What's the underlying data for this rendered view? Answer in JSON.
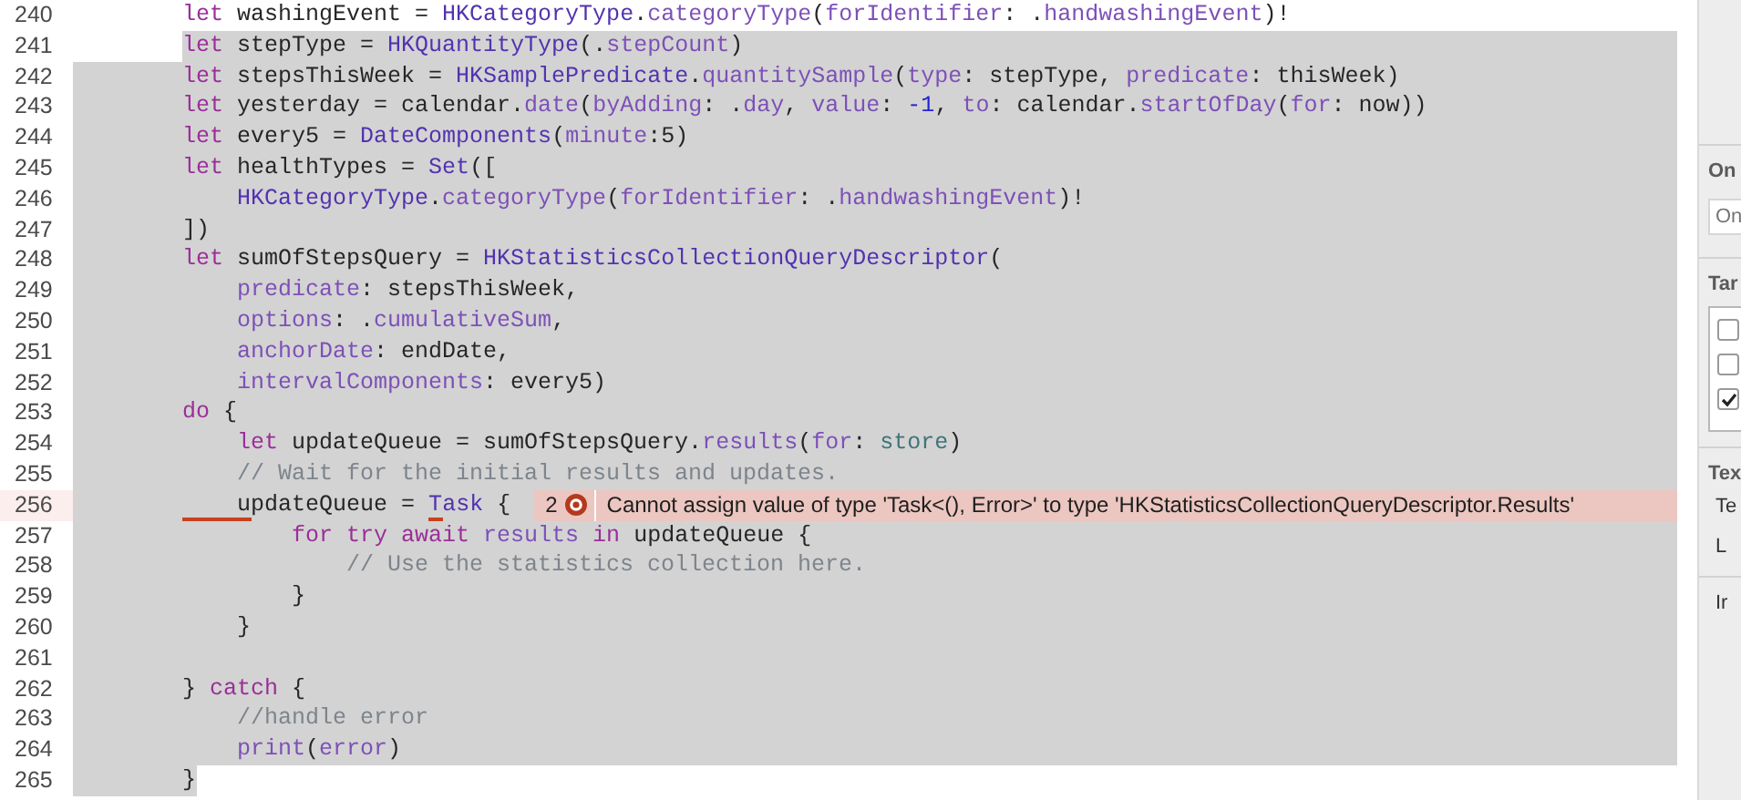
{
  "editor": {
    "lines": [
      {
        "number": "240",
        "kind": "line",
        "selected": false,
        "current": false,
        "tokens": [
          {
            "text": "let",
            "kind": "kw"
          },
          {
            "text": " washingEvent = ",
            "kind": "plain"
          },
          {
            "text": "HKCategoryType",
            "kind": "type"
          },
          {
            "text": ".",
            "kind": "plain"
          },
          {
            "text": "categoryType",
            "kind": "member"
          },
          {
            "text": "(",
            "kind": "plain"
          },
          {
            "text": "forIdentifier",
            "kind": "member"
          },
          {
            "text": ": .",
            "kind": "plain"
          },
          {
            "text": "handwashingEvent",
            "kind": "member"
          },
          {
            "text": ")!",
            "kind": "plain"
          }
        ]
      },
      {
        "number": "241",
        "kind": "selection_start",
        "selected": true,
        "current": false,
        "tokens": [
          {
            "text": "let",
            "kind": "kw"
          },
          {
            "text": " stepType = ",
            "kind": "plain"
          },
          {
            "text": "HKQuantityType",
            "kind": "type"
          },
          {
            "text": "(.",
            "kind": "plain"
          },
          {
            "text": "stepCount",
            "kind": "member"
          },
          {
            "text": ")",
            "kind": "plain"
          }
        ]
      },
      {
        "number": "242",
        "kind": "line",
        "selected": true,
        "current": false,
        "tokens": [
          {
            "text": "let",
            "kind": "kw"
          },
          {
            "text": " stepsThisWeek = ",
            "kind": "plain"
          },
          {
            "text": "HKSamplePredicate",
            "kind": "type"
          },
          {
            "text": ".",
            "kind": "plain"
          },
          {
            "text": "quantitySample",
            "kind": "member"
          },
          {
            "text": "(",
            "kind": "plain"
          },
          {
            "text": "type",
            "kind": "member"
          },
          {
            "text": ": stepType, ",
            "kind": "plain"
          },
          {
            "text": "predicate",
            "kind": "member"
          },
          {
            "text": ": thisWeek)",
            "kind": "plain"
          }
        ]
      },
      {
        "number": "243",
        "kind": "line",
        "selected": true,
        "current": false,
        "tokens": [
          {
            "text": "let",
            "kind": "kw"
          },
          {
            "text": " yesterday = calendar.",
            "kind": "plain"
          },
          {
            "text": "date",
            "kind": "member"
          },
          {
            "text": "(",
            "kind": "plain"
          },
          {
            "text": "byAdding",
            "kind": "member"
          },
          {
            "text": ": .",
            "kind": "plain"
          },
          {
            "text": "day",
            "kind": "member"
          },
          {
            "text": ", ",
            "kind": "plain"
          },
          {
            "text": "value",
            "kind": "member"
          },
          {
            "text": ": ",
            "kind": "plain"
          },
          {
            "text": "-1",
            "kind": "num"
          },
          {
            "text": ", ",
            "kind": "plain"
          },
          {
            "text": "to",
            "kind": "member"
          },
          {
            "text": ": calendar.",
            "kind": "plain"
          },
          {
            "text": "startOfDay",
            "kind": "member"
          },
          {
            "text": "(",
            "kind": "plain"
          },
          {
            "text": "for",
            "kind": "member"
          },
          {
            "text": ": now))",
            "kind": "plain"
          }
        ]
      },
      {
        "number": "244",
        "kind": "line",
        "selected": true,
        "current": false,
        "tokens": [
          {
            "text": "let",
            "kind": "kw"
          },
          {
            "text": " every5 = ",
            "kind": "plain"
          },
          {
            "text": "DateComponents",
            "kind": "type"
          },
          {
            "text": "(",
            "kind": "plain"
          },
          {
            "text": "minute",
            "kind": "member"
          },
          {
            "text": ":5)",
            "kind": "plain"
          }
        ]
      },
      {
        "number": "245",
        "kind": "line",
        "selected": true,
        "current": false,
        "tokens": [
          {
            "text": "let",
            "kind": "kw"
          },
          {
            "text": " healthTypes = ",
            "kind": "plain"
          },
          {
            "text": "Set",
            "kind": "type"
          },
          {
            "text": "([",
            "kind": "plain"
          }
        ]
      },
      {
        "number": "246",
        "kind": "line",
        "selected": true,
        "current": false,
        "tokens": [
          {
            "text": "    HKCategoryType",
            "kind": "type"
          },
          {
            "text": ".",
            "kind": "plain"
          },
          {
            "text": "categoryType",
            "kind": "member"
          },
          {
            "text": "(",
            "kind": "plain"
          },
          {
            "text": "forIdentifier",
            "kind": "member"
          },
          {
            "text": ": .",
            "kind": "plain"
          },
          {
            "text": "handwashingEvent",
            "kind": "member"
          },
          {
            "text": ")!",
            "kind": "plain"
          }
        ]
      },
      {
        "number": "247",
        "kind": "line",
        "selected": true,
        "current": false,
        "tokens": [
          {
            "text": "])",
            "kind": "plain"
          }
        ]
      },
      {
        "number": "248",
        "kind": "line",
        "selected": true,
        "current": false,
        "tokens": [
          {
            "text": "let",
            "kind": "kw"
          },
          {
            "text": " sumOfStepsQuery = ",
            "kind": "plain"
          },
          {
            "text": "HKStatisticsCollectionQueryDescriptor",
            "kind": "type"
          },
          {
            "text": "(",
            "kind": "plain"
          }
        ]
      },
      {
        "number": "249",
        "kind": "line",
        "selected": true,
        "current": false,
        "tokens": [
          {
            "text": "    predicate",
            "kind": "member"
          },
          {
            "text": ": stepsThisWeek,",
            "kind": "plain"
          }
        ]
      },
      {
        "number": "250",
        "kind": "line",
        "selected": true,
        "current": false,
        "tokens": [
          {
            "text": "    options",
            "kind": "member"
          },
          {
            "text": ": .",
            "kind": "plain"
          },
          {
            "text": "cumulativeSum",
            "kind": "member"
          },
          {
            "text": ",",
            "kind": "plain"
          }
        ]
      },
      {
        "number": "251",
        "kind": "line",
        "selected": true,
        "current": false,
        "tokens": [
          {
            "text": "    anchorDate",
            "kind": "member"
          },
          {
            "text": ": endDate,",
            "kind": "plain"
          }
        ]
      },
      {
        "number": "252",
        "kind": "line",
        "selected": true,
        "current": false,
        "tokens": [
          {
            "text": "    intervalComponents",
            "kind": "member"
          },
          {
            "text": ": every5)",
            "kind": "plain"
          }
        ]
      },
      {
        "number": "253",
        "kind": "line",
        "selected": true,
        "current": false,
        "tokens": [
          {
            "text": "do",
            "kind": "kw"
          },
          {
            "text": " {",
            "kind": "plain"
          }
        ]
      },
      {
        "number": "254",
        "kind": "line",
        "selected": true,
        "current": false,
        "tokens": [
          {
            "text": "    let",
            "kind": "kw"
          },
          {
            "text": " updateQueue = sumOfStepsQuery.",
            "kind": "plain"
          },
          {
            "text": "results",
            "kind": "member"
          },
          {
            "text": "(",
            "kind": "plain"
          },
          {
            "text": "for",
            "kind": "member"
          },
          {
            "text": ": ",
            "kind": "plain"
          },
          {
            "text": "store",
            "kind": "var"
          },
          {
            "text": ")",
            "kind": "plain"
          }
        ]
      },
      {
        "number": "255",
        "kind": "line",
        "selected": true,
        "current": false,
        "tokens": [
          {
            "text": "    // Wait for the initial results and updates.",
            "kind": "comment"
          }
        ]
      },
      {
        "number": "256",
        "kind": "line",
        "selected": true,
        "current": true,
        "tokens": [
          {
            "text": "    u",
            "kind": "plain",
            "flagged": true
          },
          {
            "text": "pdateQueue = ",
            "kind": "plain"
          },
          {
            "text": "T",
            "kind": "type",
            "flagged": true
          },
          {
            "text": "ask",
            "kind": "type"
          },
          {
            "text": " {",
            "kind": "plain"
          }
        ],
        "issue": {
          "count": "2",
          "message": "Cannot assign value of type 'Task<(), Error>' to type 'HKStatisticsCollectionQueryDescriptor.Results'"
        }
      },
      {
        "number": "257",
        "kind": "line",
        "selected": true,
        "current": false,
        "tokens": [
          {
            "text": "        for try await",
            "kind": "kw"
          },
          {
            "text": " results",
            "kind": "member"
          },
          {
            "text": " in",
            "kind": "kw"
          },
          {
            "text": " updateQueue {",
            "kind": "plain"
          }
        ]
      },
      {
        "number": "258",
        "kind": "line",
        "selected": true,
        "current": false,
        "tokens": [
          {
            "text": "            // Use the statistics collection here.",
            "kind": "comment"
          }
        ]
      },
      {
        "number": "259",
        "kind": "line",
        "selected": true,
        "current": false,
        "tokens": [
          {
            "text": "        }",
            "kind": "plain"
          }
        ]
      },
      {
        "number": "260",
        "kind": "line",
        "selected": true,
        "current": false,
        "tokens": [
          {
            "text": "    }",
            "kind": "plain"
          }
        ]
      },
      {
        "number": "261",
        "kind": "line",
        "selected": true,
        "current": false
      },
      {
        "number": "262",
        "kind": "line",
        "selected": true,
        "current": false,
        "tokens": [
          {
            "text": "} ",
            "kind": "plain"
          },
          {
            "text": "catch",
            "kind": "kw"
          },
          {
            "text": " {",
            "kind": "plain"
          }
        ]
      },
      {
        "number": "263",
        "kind": "line",
        "selected": true,
        "current": false,
        "tokens": [
          {
            "text": "    //handle error",
            "kind": "comment"
          }
        ]
      },
      {
        "number": "264",
        "kind": "line",
        "selected": true,
        "current": false,
        "tokens": [
          {
            "text": "    print",
            "kind": "member"
          },
          {
            "text": "(",
            "kind": "plain"
          },
          {
            "text": "error",
            "kind": "member"
          },
          {
            "text": ")",
            "kind": "plain"
          }
        ]
      },
      {
        "number": "265",
        "kind": "selection_end",
        "selected": true,
        "current": false,
        "tokens": [
          {
            "text": "}",
            "kind": "plain"
          }
        ]
      }
    ]
  },
  "inspector": {
    "sections": [
      {
        "heading": "On",
        "field": {
          "placeholder": "On"
        }
      },
      {
        "heading": "Tar",
        "checkboxes": [
          {
            "checked": false
          },
          {
            "checked": false
          },
          {
            "checked": true
          }
        ]
      },
      {
        "heading": "Tex",
        "labels": [
          "Te",
          "L"
        ]
      },
      {
        "labels": [
          "Ir"
        ]
      }
    ]
  }
}
